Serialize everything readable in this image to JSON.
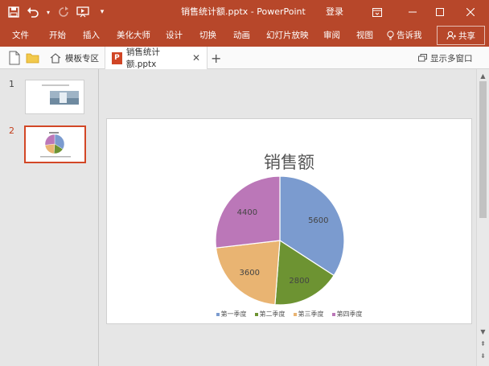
{
  "window": {
    "title": "销售统计额.pptx  -  PowerPoint",
    "login_label": "登录",
    "icons": [
      "save-icon",
      "undo-icon",
      "redo-icon",
      "present-icon",
      "customize-qat-icon"
    ]
  },
  "ribbon": {
    "tabs": [
      "文件",
      "开始",
      "插入",
      "美化大师",
      "设计",
      "切换",
      "动画",
      "幻灯片放映",
      "审阅",
      "视图"
    ],
    "tell_me": "告诉我",
    "share": "共享"
  },
  "doctabs": {
    "template_tab": "模板专区",
    "file_tab": "销售统计额.pptx",
    "multi_window": "显示多窗口"
  },
  "thumbnails": {
    "slide1_number": "1",
    "slide2_number": "2"
  },
  "chart_data": {
    "type": "pie",
    "title": "销售额",
    "categories": [
      "第一季度",
      "第二季度",
      "第三季度",
      "第四季度"
    ],
    "values": [
      5600,
      2800,
      3600,
      4400
    ],
    "data_labels": [
      "5600",
      "2800",
      "3600",
      "4400"
    ],
    "colors": [
      "#7b9bcf",
      "#6d9332",
      "#e9b472",
      "#bb77b8"
    ],
    "legend_position": "bottom"
  }
}
